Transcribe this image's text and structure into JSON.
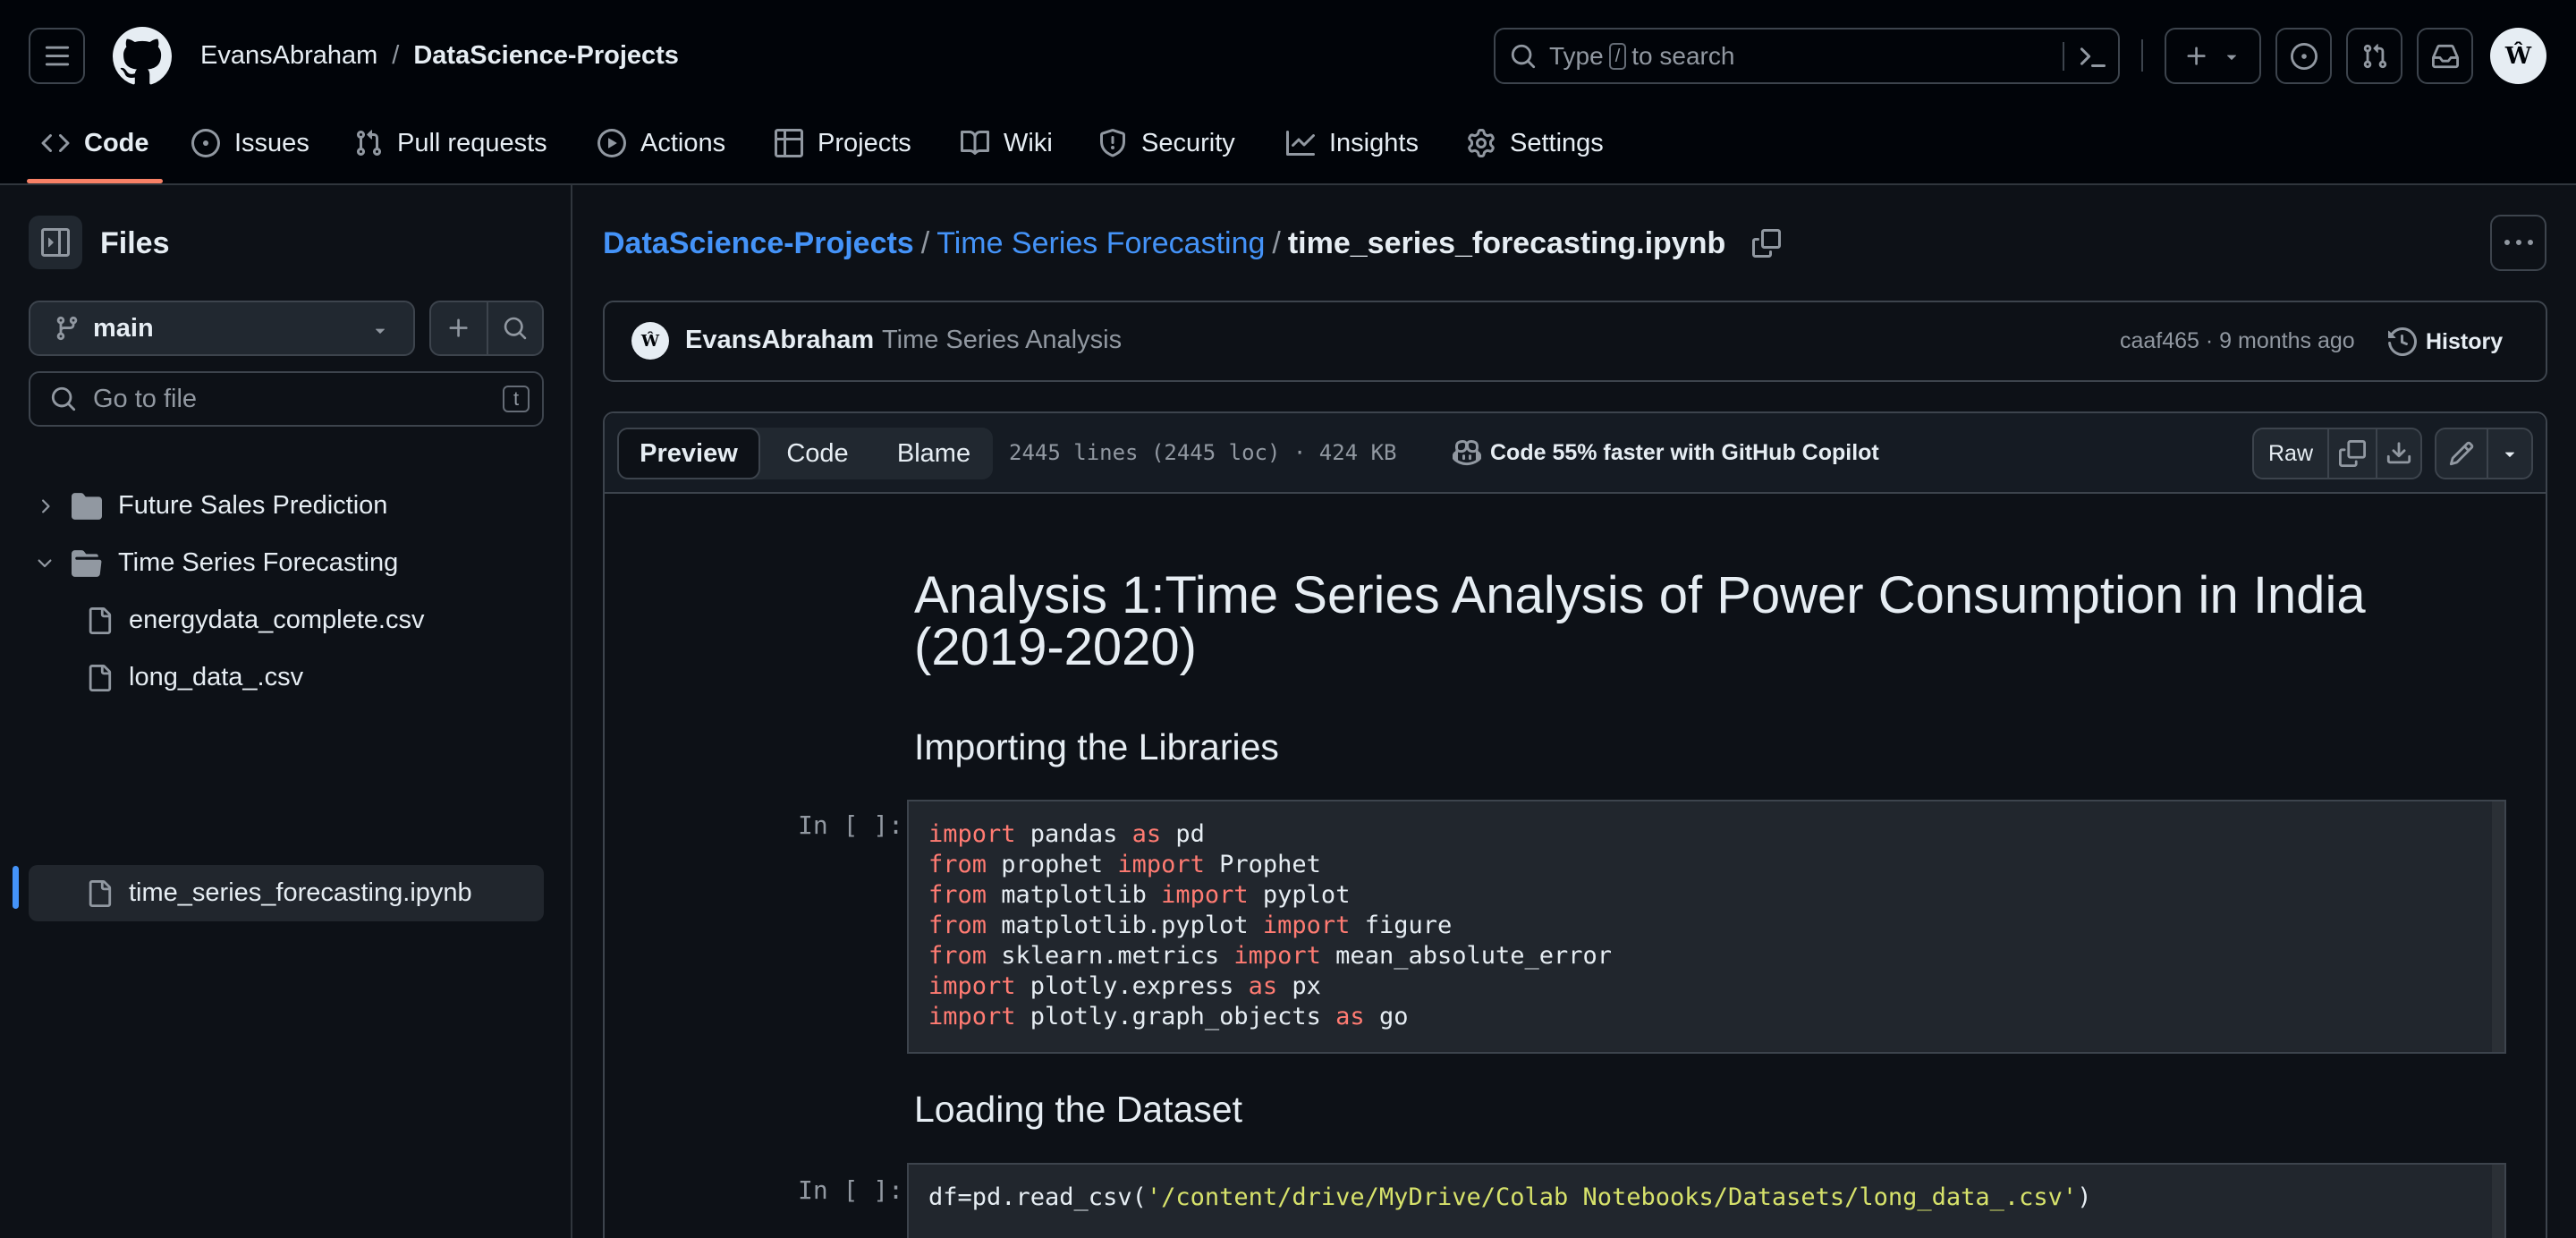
{
  "header": {
    "owner": "EvansAbraham",
    "separator": "/",
    "repo": "DataScience-Projects",
    "search_prefix": "Type",
    "search_key": "/",
    "search_suffix": "to search"
  },
  "nav": {
    "tabs": [
      {
        "label": "Code",
        "icon": "code-icon",
        "active": true
      },
      {
        "label": "Issues",
        "icon": "issue-opened-icon"
      },
      {
        "label": "Pull requests",
        "icon": "git-pull-request-icon"
      },
      {
        "label": "Actions",
        "icon": "play-icon"
      },
      {
        "label": "Projects",
        "icon": "table-icon"
      },
      {
        "label": "Wiki",
        "icon": "book-icon"
      },
      {
        "label": "Security",
        "icon": "shield-icon"
      },
      {
        "label": "Insights",
        "icon": "graph-icon"
      },
      {
        "label": "Settings",
        "icon": "gear-icon"
      }
    ]
  },
  "sidebar": {
    "title": "Files",
    "branch": "main",
    "goto_placeholder": "Go to file",
    "goto_key": "t",
    "tree": [
      {
        "label": "Future Sales Prediction",
        "type": "folder",
        "expanded": false
      },
      {
        "label": "Time Series Forecasting",
        "type": "folder",
        "expanded": true
      },
      {
        "label": "energydata_complete.csv",
        "type": "file"
      },
      {
        "label": "long_data_.csv",
        "type": "file"
      },
      {
        "label": "time_series_forecasting.ipynb",
        "type": "file",
        "selected": true
      }
    ]
  },
  "breadcrumb": {
    "repo": "DataScience-Projects",
    "folder": "Time Series Forecasting",
    "file": "time_series_forecasting.ipynb",
    "sep": "/"
  },
  "commit": {
    "author": "EvansAbraham",
    "message": "Time Series Analysis",
    "meta": "caaf465 · 9 months ago",
    "history_label": "History"
  },
  "file_toolbar": {
    "tabs": [
      "Preview",
      "Code",
      "Blame"
    ],
    "active_tab": "Preview",
    "stats": "2445 lines (2445 loc) · 424 KB",
    "copilot": "Code 55% faster with GitHub Copilot",
    "raw_label": "Raw"
  },
  "notebook": {
    "title_line1": "Analysis 1:Time Series Analysis of Power Consumption in India",
    "title_line2": "(2019-2020)",
    "heading1": "Importing the Libraries",
    "heading2": "Loading the Dataset",
    "prompt": "In [ ]:",
    "cell1": [
      [
        [
          "kw",
          "import"
        ],
        [
          "t",
          " pandas "
        ],
        [
          "kw",
          "as"
        ],
        [
          "t",
          " pd"
        ]
      ],
      [
        [
          "kw",
          "from"
        ],
        [
          "t",
          " prophet "
        ],
        [
          "kw",
          "import"
        ],
        [
          "t",
          " Prophet"
        ]
      ],
      [
        [
          "kw",
          "from"
        ],
        [
          "t",
          " matplotlib "
        ],
        [
          "kw",
          "import"
        ],
        [
          "t",
          " pyplot"
        ]
      ],
      [
        [
          "kw",
          "from"
        ],
        [
          "t",
          " matplotlib.pyplot "
        ],
        [
          "kw",
          "import"
        ],
        [
          "t",
          " figure"
        ]
      ],
      [
        [
          "kw",
          "from"
        ],
        [
          "t",
          " sklearn.metrics "
        ],
        [
          "kw",
          "import"
        ],
        [
          "t",
          " mean_absolute_error"
        ]
      ],
      [
        [
          "kw",
          "import"
        ],
        [
          "t",
          " plotly.express "
        ],
        [
          "kw",
          "as"
        ],
        [
          "t",
          " px"
        ]
      ],
      [
        [
          "kw",
          "import"
        ],
        [
          "t",
          " plotly.graph_objects "
        ],
        [
          "kw",
          "as"
        ],
        [
          "t",
          " go"
        ]
      ]
    ],
    "cell2": [
      [
        [
          "t",
          "df=pd.read_csv("
        ],
        [
          "str",
          "'/content/drive/MyDrive/Colab Notebooks/Datasets/long_data_.csv'"
        ],
        [
          "t",
          ")"
        ]
      ]
    ]
  },
  "colors": {
    "background": "#0d1117",
    "header": "#010409",
    "accent_link": "#4493f8",
    "nav_underline": "#f78166",
    "selected_indicator": "#4493f8"
  }
}
